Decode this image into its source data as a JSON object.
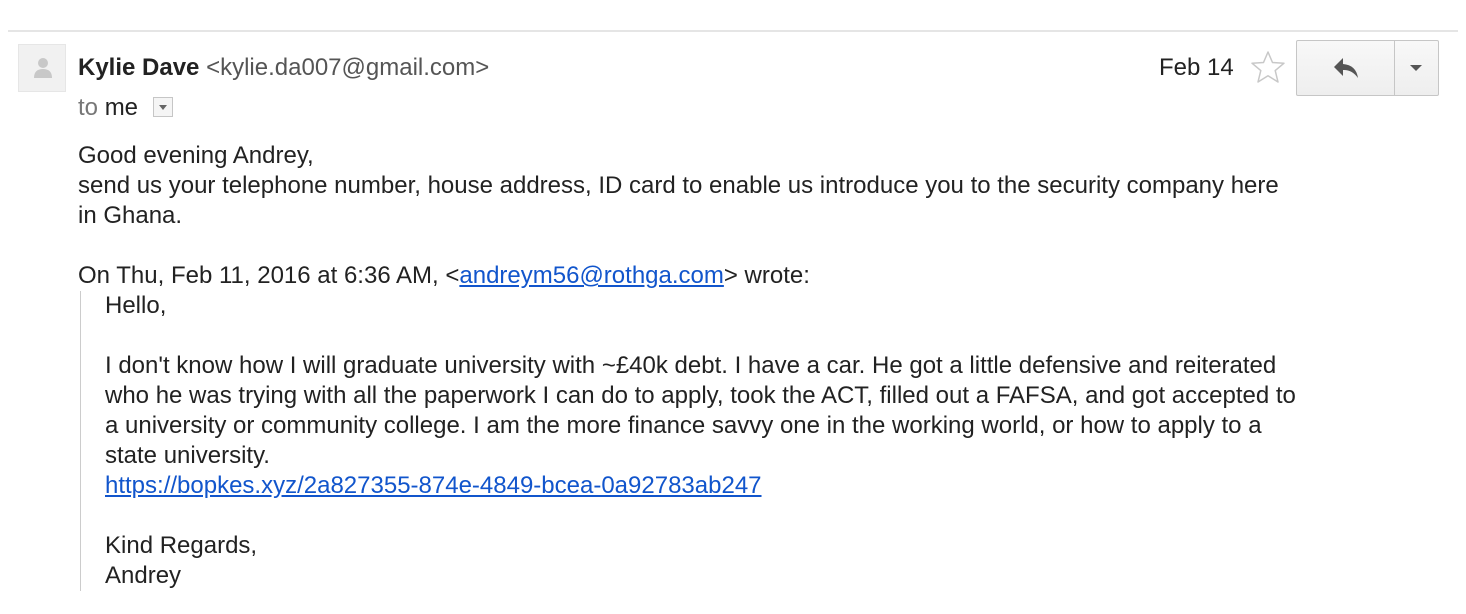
{
  "header": {
    "sender_name": "Kylie Dave",
    "sender_email": "<kylie.da007@gmail.com>",
    "to_prefix": "to",
    "to_value": "me",
    "date": "Feb 14"
  },
  "icons": {
    "avatar": "person-avatar-icon",
    "star": "star-outline-icon",
    "reply": "reply-arrow-icon",
    "more": "dropdown-caret-icon"
  },
  "colors": {
    "link": "#1155cc",
    "text": "#222222",
    "muted": "#777777",
    "quote_border": "#cccccc"
  },
  "message": {
    "greeting": "Good evening Andrey,",
    "line1": "send us your telephone number, house address, ID card  to enable us introduce you to the security company here",
    "line2": "in Ghana.",
    "quote_intro_before": "On Thu, Feb 11, 2016 at 6:36 AM, <",
    "quote_intro_email": "andreym56@rothga.com",
    "quote_intro_after": "> wrote:"
  },
  "quoted": {
    "hello": "Hello,",
    "p1": "I don't know how I will graduate university with ~£40k debt. I have a car. He got a little defensive and reiterated",
    "p2": "who he was trying with all the paperwork I can do to apply, took the ACT, filled out a FAFSA, and got accepted to",
    "p3": "a university or community college. I am the more finance savvy one in the working world, or how to apply to a",
    "p4": "state university.",
    "link": "https://bopkes.xyz/2a827355-874e-4849-bcea-0a92783ab247",
    "sign1": "Kind Regards,",
    "sign2": "Andrey"
  }
}
